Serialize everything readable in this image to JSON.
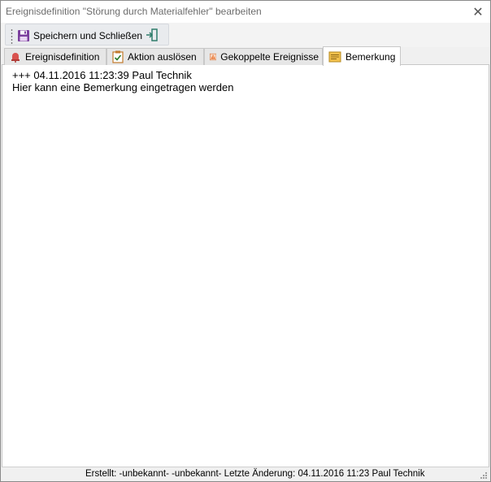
{
  "window": {
    "title": "Ereignisdefinition \"Störung durch Materialfehler\" bearbeiten",
    "close_glyph": "✕"
  },
  "toolbar": {
    "save_label": "Speichern und Schließen",
    "save_icon": "floppy-disk-icon",
    "exit_icon": "exit-door-icon"
  },
  "tabs": [
    {
      "label": "Ereignisdefinition",
      "icon": "event-bell-icon",
      "active": false
    },
    {
      "label": "Aktion auslösen",
      "icon": "checklist-icon",
      "active": false
    },
    {
      "label": "Gekoppelte Ereignisse",
      "icon": "warning-icon",
      "active": false
    },
    {
      "label": "Bemerkung",
      "icon": "note-icon",
      "active": true
    }
  ],
  "remark": {
    "line1": "+++ 04.11.2016 11:23:39 Paul Technik",
    "line2": "Hier kann eine Bemerkung eingetragen werden"
  },
  "status": {
    "text": "Erstellt: -unbekannt- -unbekannt-  Letzte Änderung: 04.11.2016 11:23 Paul Technik"
  },
  "colors": {
    "accent_purple": "#7b3f9e",
    "warning_orange": "#e8702a",
    "note_yellow": "#f2c14e"
  }
}
